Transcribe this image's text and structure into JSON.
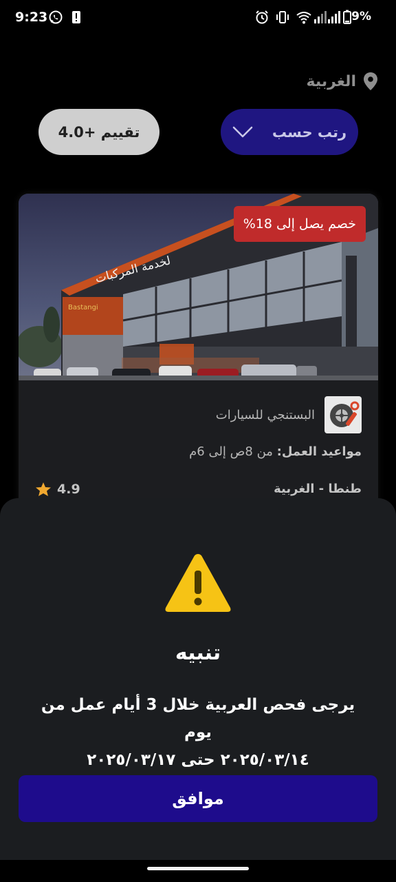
{
  "status_bar": {
    "time": "9:23",
    "battery": "9%"
  },
  "location": {
    "label": "الغربية",
    "icon": "location-pin-icon"
  },
  "filters": {
    "sort_label": "رتب حسب",
    "rating_label": "تقييم +4.0"
  },
  "card": {
    "discount": "خصم يصل إلى 18%",
    "name": "البستنجي للسيارات",
    "hours_label": "مواعيد العمل:",
    "hours_value": " من 8ص إلى 6م",
    "address": "طنطا - الغربية",
    "rating": "4.9",
    "building_sign": "لخدمة المركبات"
  },
  "alert": {
    "title": "تنبيه",
    "message_line1": "يرجى فحص العربية خلال 3 أيام عمل من يوم",
    "message_line2": "٢٠٢٥/٠٣/١٤ حتى ٢٠٢٥/٠٣/١٧",
    "confirm": "موافق"
  },
  "colors": {
    "accent": "#1e0c8c",
    "discount": "#c02b2b",
    "warning": "#f6c315",
    "star": "#f0a830"
  }
}
